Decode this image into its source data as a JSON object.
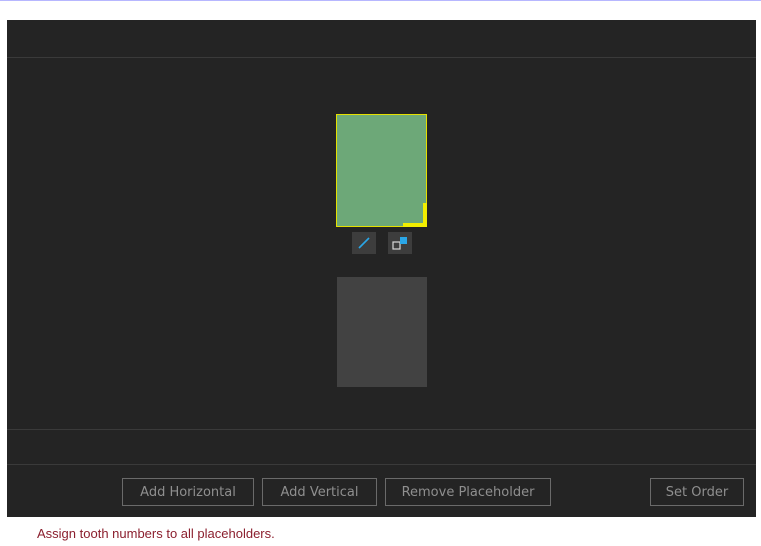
{
  "toolbar": {
    "add_horizontal": "Add Horizontal",
    "add_vertical": "Add Vertical",
    "remove_placeholder": "Remove Placeholder",
    "set_order": "Set Order"
  },
  "placeholder_tools": {
    "edit_icon": "pencil-icon",
    "reassign_icon": "swap-placeholders-icon"
  },
  "status": {
    "message": "Assign tooth numbers to all placeholders."
  },
  "colors": {
    "editor_background": "#242424",
    "selected_fill": "#6da878",
    "selection_highlight": "#f2ee00",
    "empty_fill": "#424242",
    "status_text": "#8b1f2e",
    "icon_accent": "#2aa7e8"
  }
}
